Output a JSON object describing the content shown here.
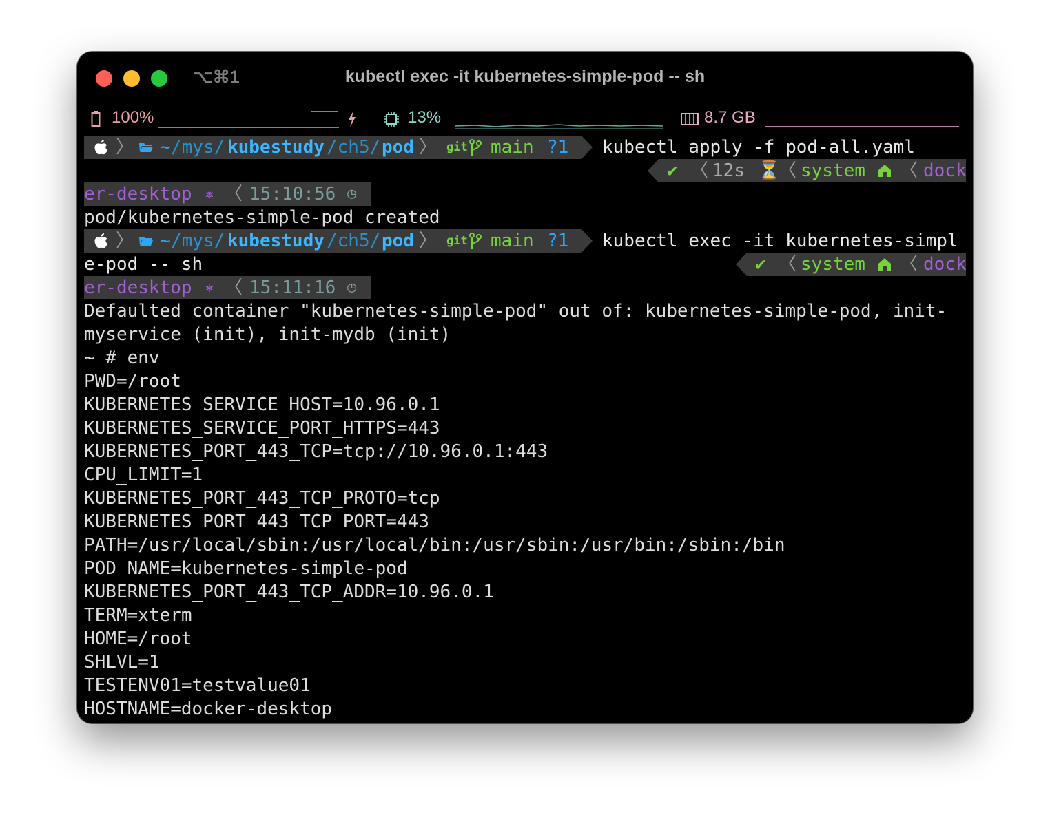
{
  "window": {
    "shortcut": "⌥⌘1",
    "title": "kubectl exec -it kubernetes-simple-pod -- sh"
  },
  "status_bar": {
    "battery": "100%",
    "cpu": "13%",
    "memory": "8.7 GB"
  },
  "prompt1": {
    "path_home": "~",
    "path_1": "/mys/",
    "path_2": "kubestudy",
    "path_3": "/ch5/",
    "path_4": "pod",
    "git_label": "git",
    "branch": "main",
    "untracked": "?1",
    "command": "kubectl apply -f pod-all.yaml",
    "status_ok": "✔",
    "duration": "12s",
    "context": "system",
    "kube_ctx_head": "dock",
    "kube_ctx_tail": "er-desktop",
    "time": "15:10:56"
  },
  "output1": "pod/kubernetes-simple-pod created",
  "prompt2": {
    "path_home": "~",
    "path_1": "/mys/",
    "path_2": "kubestudy",
    "path_3": "/ch5/",
    "path_4": "pod",
    "git_label": "git",
    "branch": "main",
    "untracked": "?1",
    "command": "kubectl exec -it kubernetes-simpl",
    "command_cont": "e-pod -- sh",
    "status_ok": "✔",
    "context": "system",
    "kube_ctx_head": "dock",
    "kube_ctx_tail": "er-desktop",
    "time": "15:11:16"
  },
  "output_lines": [
    "Defaulted container \"kubernetes-simple-pod\" out of: kubernetes-simple-pod, init-",
    "myservice (init), init-mydb (init)",
    "~ # env",
    "PWD=/root",
    "KUBERNETES_SERVICE_HOST=10.96.0.1",
    "KUBERNETES_SERVICE_PORT_HTTPS=443",
    "KUBERNETES_PORT_443_TCP=tcp://10.96.0.1:443",
    "CPU_LIMIT=1",
    "KUBERNETES_PORT_443_TCP_PROTO=tcp",
    "KUBERNETES_PORT_443_TCP_PORT=443",
    "PATH=/usr/local/sbin:/usr/local/bin:/usr/sbin:/usr/bin:/sbin:/bin",
    "POD_NAME=kubernetes-simple-pod",
    "KUBERNETES_PORT_443_TCP_ADDR=10.96.0.1",
    "TERM=xterm",
    "HOME=/root",
    "SHLVL=1",
    "TESTENV01=testvalue01",
    "HOSTNAME=docker-desktop"
  ],
  "colors": {
    "background": "#000000",
    "segment": "#3a3a3a",
    "directory": "#2ea6f7",
    "git": "#76d33a",
    "kube": "#a35fd6",
    "battery": "#e0a2a6",
    "cpu": "#8fd6cc",
    "memory": "#e8a8c8"
  }
}
